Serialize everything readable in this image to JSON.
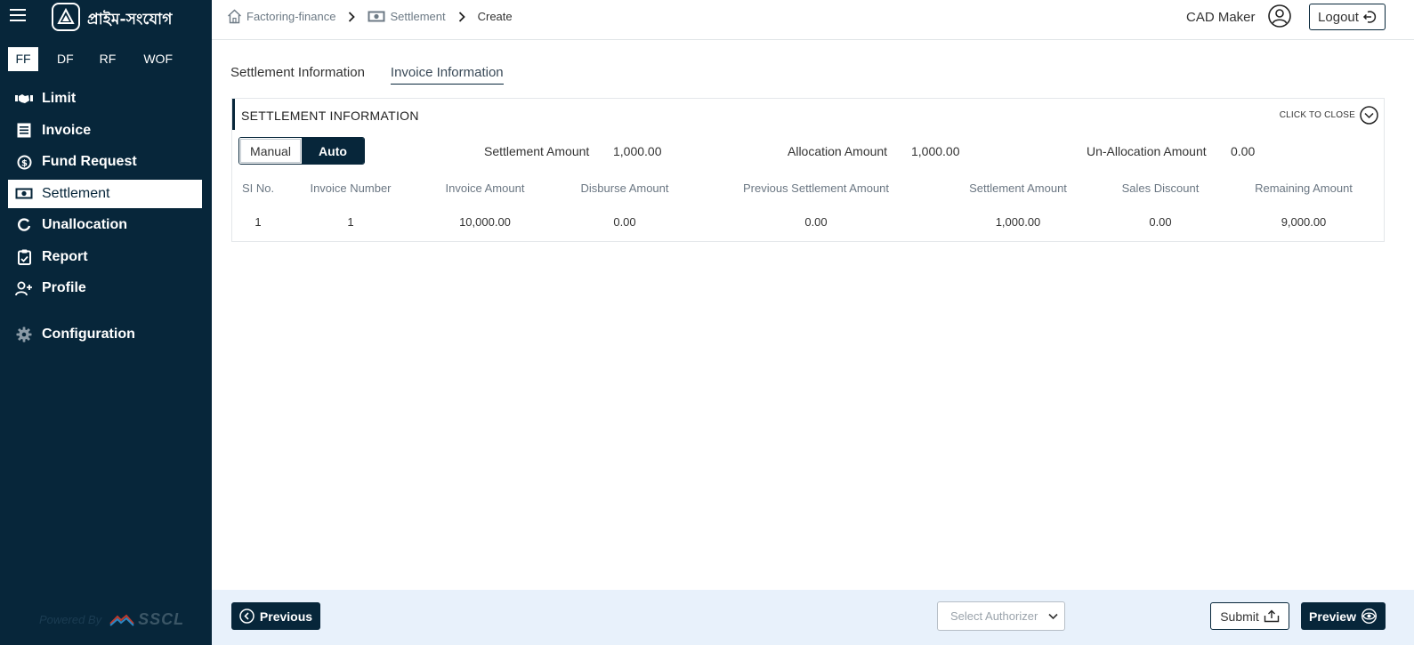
{
  "brand": {
    "name": "প্রাইম-সংযোগ"
  },
  "modules": [
    {
      "label": "FF",
      "active": true
    },
    {
      "label": "DF"
    },
    {
      "label": "RF"
    },
    {
      "label": "WOF"
    }
  ],
  "nav": [
    {
      "label": "Limit",
      "icon": "handshake-icon"
    },
    {
      "label": "Invoice",
      "icon": "invoice-icon"
    },
    {
      "label": "Fund Request",
      "icon": "fund-icon"
    },
    {
      "label": "Settlement",
      "icon": "banknote-icon",
      "active": true
    },
    {
      "label": "Unallocation",
      "icon": "refresh-icon"
    },
    {
      "label": "Report",
      "icon": "clipboard-icon"
    },
    {
      "label": "Profile",
      "icon": "user-plus-icon"
    },
    {
      "label": "Configuration",
      "icon": "gear-icon"
    }
  ],
  "powered": {
    "text": "Powered By",
    "company": "SSCL"
  },
  "breadcrumb": {
    "home": "Factoring-finance",
    "section": "Settlement",
    "current": "Create"
  },
  "header": {
    "user": "CAD Maker",
    "logout": "Logout"
  },
  "tabs": [
    {
      "label": "Settlement Information"
    },
    {
      "label": "Invoice Information",
      "active": true
    }
  ],
  "panel": {
    "title": "SETTLEMENT INFORMATION",
    "toggle": "CLICK TO CLOSE",
    "mode": {
      "manual": "Manual",
      "auto": "Auto",
      "selected": "Auto"
    },
    "amounts": {
      "settlement_label": "Settlement Amount",
      "settlement_value": "1,000.00",
      "allocation_label": "Allocation Amount",
      "allocation_value": "1,000.00",
      "unallocation_label": "Un-Allocation Amount",
      "unallocation_value": "0.00"
    },
    "table": {
      "headers": [
        "SI No.",
        "Invoice Number",
        "Invoice Amount",
        "Disburse Amount",
        "Previous Settlement Amount",
        "Settlement Amount",
        "Sales Discount",
        "Remaining Amount"
      ],
      "rows": [
        [
          "1",
          "1",
          "10,000.00",
          "0.00",
          "0.00",
          "1,000.00",
          "0.00",
          "9,000.00"
        ]
      ]
    }
  },
  "footer": {
    "previous": "Previous",
    "authorizer_placeholder": "Select Authorizer",
    "submit": "Submit",
    "preview": "Preview"
  },
  "colors": {
    "navy": "#07263a",
    "footer_bg": "#e8f1fb"
  }
}
